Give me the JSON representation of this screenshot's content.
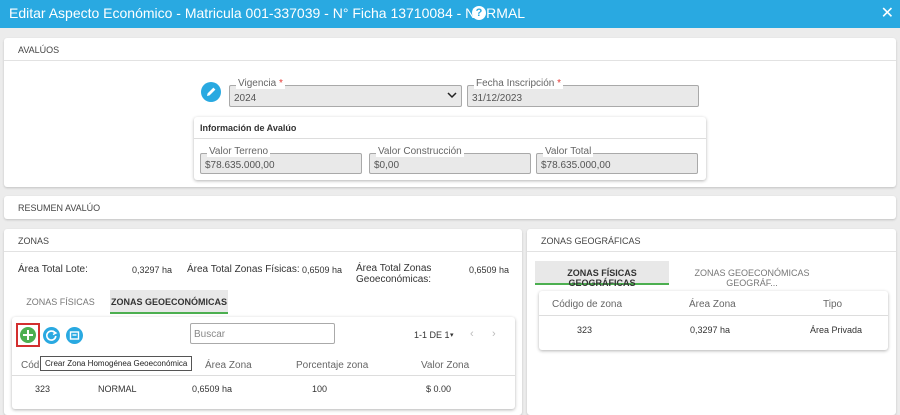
{
  "dialog": {
    "title": "Editar Aspecto Económico - Matricula 001-337039 - N° Ficha 13710084 - NORMAL",
    "help_glyph": "?",
    "close_glyph": "✕"
  },
  "avaluos": {
    "header": "AVALÚOS",
    "vigencia": {
      "label": "Vigencia",
      "required_mark": "*",
      "value": "2024"
    },
    "fecha_inscripcion": {
      "label": "Fecha Inscripción",
      "required_mark": "*",
      "value": "31/12/2023"
    },
    "info": {
      "title": "Información de Avalúo",
      "valor_terreno": {
        "label": "Valor Terreno",
        "value": "$78.635.000,00"
      },
      "valor_construccion": {
        "label": "Valor Construcción",
        "value": "$0,00"
      },
      "valor_total": {
        "label": "Valor Total",
        "value": "$78.635.000,00"
      }
    }
  },
  "resumen": {
    "header": "RESUMEN AVALÚO"
  },
  "zonas": {
    "header": "ZONAS",
    "area_total_lote_label": "Área Total Lote:",
    "area_total_lote_value": "0,3297 ha",
    "area_total_fisicas_label": "Área Total Zonas Físicas:",
    "area_total_fisicas_value": "0,6509 ha",
    "area_total_geo_label": "Área Total Zonas Geoeconómicas:",
    "area_total_geo_value": "0,6509 ha",
    "tabs": [
      {
        "label": "ZONAS FÍSICAS"
      },
      {
        "label": "ZONAS GEOECONÓMICAS"
      }
    ],
    "search_placeholder": "Buscar",
    "pagination": "1-1 DE 1",
    "tooltip": "Crear Zona Homogénea Geoeconómica",
    "columns": [
      "Cód",
      "Área Zona",
      "Porcentaje zona",
      "Valor Zona"
    ],
    "rows": [
      {
        "codigo": "323",
        "nombre": "NORMAL",
        "area": "0,6509 ha",
        "porcentaje": "100",
        "valor": "$ 0.00"
      }
    ]
  },
  "zonas_geo": {
    "header": "ZONAS GEOGRÁFICAS",
    "tabs": [
      {
        "label": "ZONAS FÍSICAS GEOGRÁFICAS"
      },
      {
        "label": "ZONAS GEOECONÓMICAS GEOGRÁF..."
      }
    ],
    "columns": [
      "Código de zona",
      "Área Zona",
      "Tipo"
    ],
    "rows": [
      {
        "codigo": "323",
        "area": "0,3297 ha",
        "tipo": "Área Privada"
      }
    ]
  },
  "icons": {
    "edit": "pencil-icon",
    "add": "plus-icon",
    "refresh": "refresh-icon",
    "export": "export-icon"
  },
  "colors": {
    "titlebar": "#29a9e1",
    "accent_green": "#4caf50",
    "icon_blue": "#29a9e1",
    "highlight_red": "#d32f2f"
  }
}
